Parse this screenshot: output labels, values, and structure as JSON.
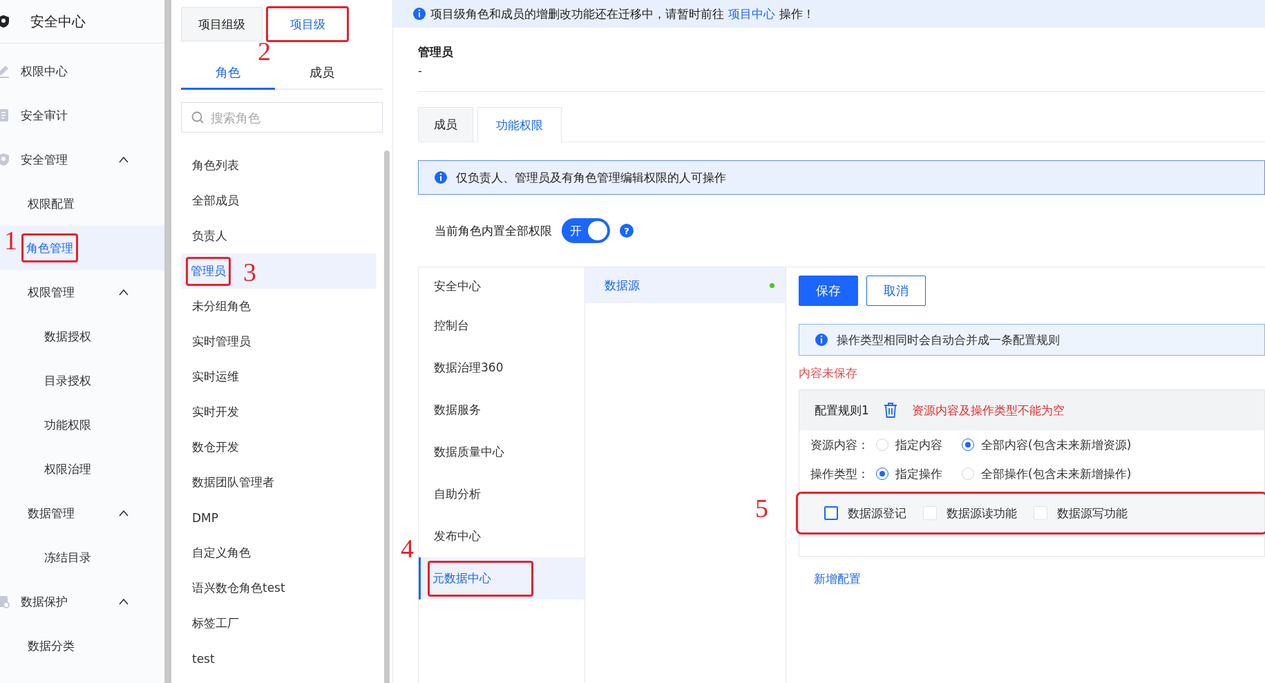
{
  "sidebar": {
    "title": "安全中心",
    "items": [
      {
        "label": "权限中心",
        "selected": false
      },
      {
        "label": "安全审计",
        "selected": false
      },
      {
        "label": "安全管理",
        "selected": false,
        "expanded": true,
        "children": [
          {
            "label": "权限配置",
            "selected": false
          },
          {
            "label": "角色管理",
            "selected": true,
            "annotation": {
              "label": "1"
            }
          },
          {
            "label": "权限管理",
            "selected": false,
            "expanded": true,
            "children": [
              {
                "label": "数据授权",
                "selected": false
              },
              {
                "label": "目录授权",
                "selected": false
              },
              {
                "label": "功能权限",
                "selected": false
              },
              {
                "label": "权限治理",
                "selected": false
              }
            ]
          },
          {
            "label": "数据管理",
            "selected": false,
            "expanded": true,
            "children": [
              {
                "label": "冻结目录",
                "selected": false
              }
            ]
          }
        ]
      },
      {
        "label": "数据保护",
        "selected": false,
        "expanded": true,
        "children": [
          {
            "label": "数据分类",
            "selected": false
          }
        ]
      }
    ]
  },
  "role_panel": {
    "level_tabs": [
      {
        "label": "项目组级",
        "selected": false
      },
      {
        "label": "项目级",
        "selected": true,
        "annotation": {
          "label": "2"
        }
      }
    ],
    "tabs": [
      {
        "label": "角色",
        "selected": true
      },
      {
        "label": "成员",
        "selected": false
      }
    ],
    "search": {
      "placeholder": "搜索角色"
    },
    "roles": [
      {
        "label": "角色列表",
        "selected": false
      },
      {
        "label": "全部成员",
        "selected": false
      },
      {
        "label": "负责人",
        "selected": false
      },
      {
        "label": "管理员",
        "selected": true,
        "annotation": {
          "label": "3"
        }
      },
      {
        "label": "未分组角色",
        "selected": false
      },
      {
        "label": "实时管理员",
        "selected": false
      },
      {
        "label": "实时运维",
        "selected": false
      },
      {
        "label": "实时开发",
        "selected": false
      },
      {
        "label": "数仓开发",
        "selected": false
      },
      {
        "label": "数据团队管理者",
        "selected": false
      },
      {
        "label": "DMP",
        "selected": false
      },
      {
        "label": "自定义角色",
        "selected": false
      },
      {
        "label": "语兴数仓角色test",
        "selected": false
      },
      {
        "label": "标签工厂",
        "selected": false
      },
      {
        "label": "test",
        "selected": false
      }
    ]
  },
  "banner": {
    "before": "项目级角色和成员的增删改功能还在迁移中，请暂时前往",
    "link": "项目中心",
    "after": "操作！"
  },
  "role": {
    "name": "管理员",
    "description": "-"
  },
  "detail_tabs": [
    {
      "label": "成员",
      "selected": false
    },
    {
      "label": "功能权限",
      "selected": true
    }
  ],
  "notice": "仅负责人、管理员及有角色管理编辑权限的人可操作",
  "builtin_switch": {
    "label": "当前角色内置全部权限",
    "on": true,
    "text": "开",
    "help": "?"
  },
  "modules": [
    {
      "label": "安全中心",
      "selected": false
    },
    {
      "label": "控制台",
      "selected": false
    },
    {
      "label": "数据治理360",
      "selected": false
    },
    {
      "label": "数据服务",
      "selected": false
    },
    {
      "label": "数据质量中心",
      "selected": false
    },
    {
      "label": "自助分析",
      "selected": false
    },
    {
      "label": "发布中心",
      "selected": false
    },
    {
      "label": "元数据中心",
      "selected": true,
      "annotation": {
        "label": "4"
      }
    }
  ],
  "resources": [
    {
      "label": "数据源",
      "selected": true,
      "color": "#52c41a"
    }
  ],
  "editor": {
    "buttons": [
      {
        "label": "保存",
        "kind": "primary"
      },
      {
        "label": "取消",
        "kind": "default"
      }
    ],
    "tip": "操作类型相同时会自动合并成一条配置规则",
    "unsaved": "内容未保存",
    "rule": {
      "title": "配置规则1",
      "error": "资源内容及操作类型不能为空",
      "options": [
        {
          "label": "资源内容：",
          "choices": [
            {
              "label": "指定内容",
              "selected": false
            },
            {
              "label": "全部内容(包含未来新增资源)",
              "selected": true
            }
          ]
        },
        {
          "label": "操作类型：",
          "choices": [
            {
              "label": "指定操作",
              "selected": true
            },
            {
              "label": "全部操作(包含未来新增操作)",
              "selected": false
            }
          ]
        }
      ],
      "permissions": {
        "annotation": {
          "label": "5"
        },
        "items": [
          {
            "label": "数据源登记",
            "checked": false,
            "focused": true
          },
          {
            "label": "数据源读功能",
            "checked": false,
            "focused": false
          },
          {
            "label": "数据源写功能",
            "checked": false,
            "focused": false
          }
        ]
      }
    },
    "add_link": "新增配置"
  }
}
